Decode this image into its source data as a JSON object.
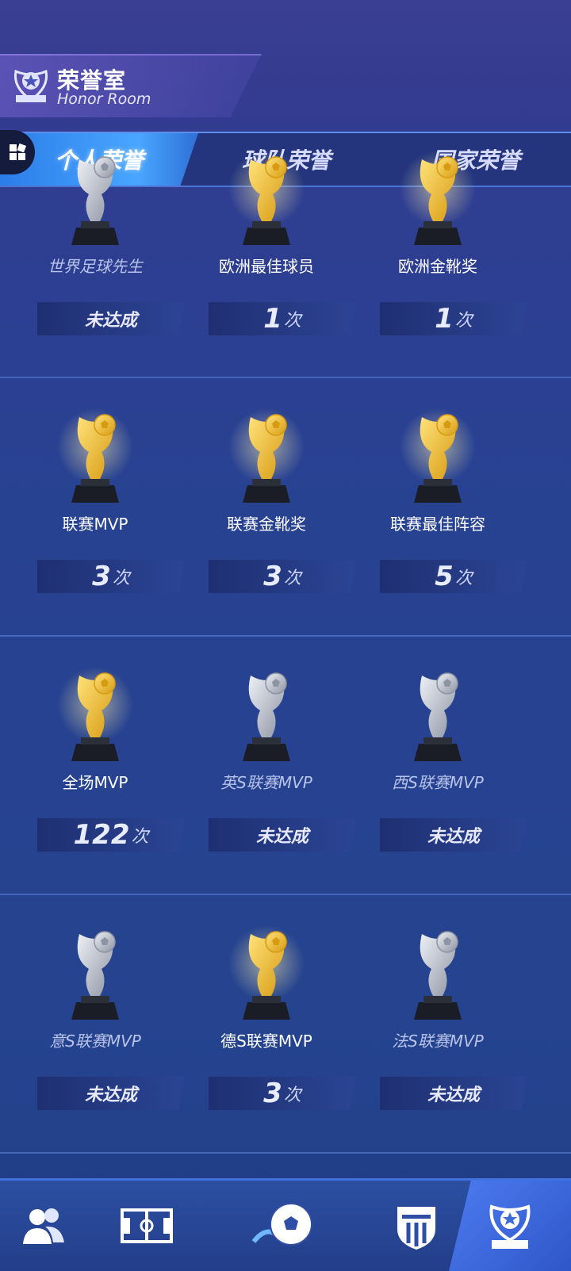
{
  "header": {
    "title": "荣誉室",
    "subtitle": "Honor Room",
    "emblem_icon": "trophy-emblem-icon"
  },
  "tabs": [
    {
      "label": "个人荣誉",
      "active": true
    },
    {
      "label": "球队荣誉",
      "active": false
    },
    {
      "label": "国家荣誉",
      "active": false
    }
  ],
  "trophies": [
    {
      "name": "世界足球先生",
      "count": "未达成",
      "unit": "",
      "achieved": false,
      "material": "silver"
    },
    {
      "name": "欧洲最佳球员",
      "count": "1",
      "unit": "次",
      "achieved": true,
      "material": "gold"
    },
    {
      "name": "欧洲金靴奖",
      "count": "1",
      "unit": "次",
      "achieved": true,
      "material": "gold"
    },
    {
      "name": "联赛MVP",
      "count": "3",
      "unit": "次",
      "achieved": true,
      "material": "gold"
    },
    {
      "name": "联赛金靴奖",
      "count": "3",
      "unit": "次",
      "achieved": true,
      "material": "gold"
    },
    {
      "name": "联赛最佳阵容",
      "count": "5",
      "unit": "次",
      "achieved": true,
      "material": "gold"
    },
    {
      "name": "全场MVP",
      "count": "122",
      "unit": "次",
      "achieved": true,
      "material": "gold"
    },
    {
      "name": "英S联赛MVP",
      "count": "未达成",
      "unit": "",
      "achieved": false,
      "material": "silver"
    },
    {
      "name": "西S联赛MVP",
      "count": "未达成",
      "unit": "",
      "achieved": false,
      "material": "silver"
    },
    {
      "name": "意S联赛MVP",
      "count": "未达成",
      "unit": "",
      "achieved": false,
      "material": "silver"
    },
    {
      "name": "德S联赛MVP",
      "count": "3",
      "unit": "次",
      "achieved": true,
      "material": "gold"
    },
    {
      "name": "法S联赛MVP",
      "count": "未达成",
      "unit": "",
      "achieved": false,
      "material": "silver"
    }
  ],
  "bottom_nav": [
    {
      "icon": "players-icon",
      "active": false
    },
    {
      "icon": "pitch-icon",
      "active": false
    },
    {
      "icon": "soccer-ball-icon",
      "active": false
    },
    {
      "icon": "club-crest-icon",
      "active": false
    },
    {
      "icon": "trophy-icon",
      "active": true
    }
  ],
  "colors": {
    "gold": "#f2c230",
    "silver": "#c9cdd6",
    "accent": "#4aa3ff",
    "background": "#263f8f"
  }
}
